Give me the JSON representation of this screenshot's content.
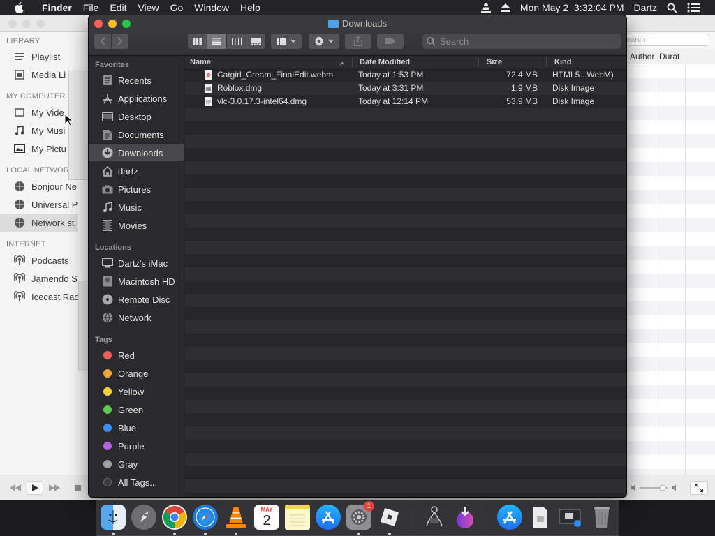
{
  "menubar": {
    "app_name": "Finder",
    "menus": [
      "File",
      "Edit",
      "View",
      "Go",
      "Window",
      "Help"
    ],
    "datetime": "Mon May 2  3:32:04 PM",
    "user": "Dartz"
  },
  "vlc": {
    "sections": {
      "library": "LIBRARY",
      "my_computer": "MY COMPUTER",
      "local_network": "LOCAL NETWORK",
      "internet": "INTERNET"
    },
    "items": {
      "playlist": "Playlist",
      "media_library": "Media Li",
      "my_videos": "My Vide",
      "my_music": "My Musi",
      "my_pictures": "My Pictu",
      "bonjour": "Bonjour Ne",
      "universal_plug": "Universal P",
      "network_streams": "Network st",
      "podcasts": "Podcasts",
      "jamendo": "Jamendo S",
      "icecast": "Icecast Rad"
    },
    "search_placeholder": "earch",
    "columns": [
      "Author",
      "Durat"
    ]
  },
  "finder": {
    "title": "Downloads",
    "search_placeholder": "Search",
    "sections": {
      "favorites": "Favorites",
      "locations": "Locations",
      "tags": "Tags"
    },
    "favorites": [
      "Recents",
      "Applications",
      "Desktop",
      "Documents",
      "Downloads",
      "dartz",
      "Pictures",
      "Music",
      "Movies"
    ],
    "locations": [
      "Dartz's iMac",
      "Macintosh HD",
      "Remote Disc",
      "Network"
    ],
    "tags": [
      {
        "label": "Red",
        "color": "#ec5f5a"
      },
      {
        "label": "Orange",
        "color": "#f5a83a"
      },
      {
        "label": "Yellow",
        "color": "#f4d33f"
      },
      {
        "label": "Green",
        "color": "#5ccc4f"
      },
      {
        "label": "Blue",
        "color": "#3b8ff0"
      },
      {
        "label": "Purple",
        "color": "#b763dd"
      },
      {
        "label": "Gray",
        "color": "#a3a3a6"
      },
      {
        "label": "All Tags...",
        "color": "#3b3b3d"
      }
    ],
    "columns": {
      "name": "Name",
      "date_modified": "Date Modified",
      "size": "Size",
      "kind": "Kind"
    },
    "files": [
      {
        "name": "Catgirl_Cream_FinalEdit.webm",
        "date": "Today at 1:53 PM",
        "size": "72.4 MB",
        "kind": "HTML5...WebM)"
      },
      {
        "name": "Roblox.dmg",
        "date": "Today at 3:31 PM",
        "size": "1.9 MB",
        "kind": "Disk Image"
      },
      {
        "name": "vlc-3.0.17.3-intel64.dmg",
        "date": "Today at 12:14 PM",
        "size": "53.9 MB",
        "kind": "Disk Image"
      }
    ]
  },
  "dock": {
    "calendar_month": "MAY",
    "calendar_day": "2",
    "badge": "1"
  },
  "colors": {
    "accent_blue": "#4ea3e6",
    "close": "#fd5f57",
    "minimize": "#febc2e",
    "zoom": "#27c840"
  }
}
